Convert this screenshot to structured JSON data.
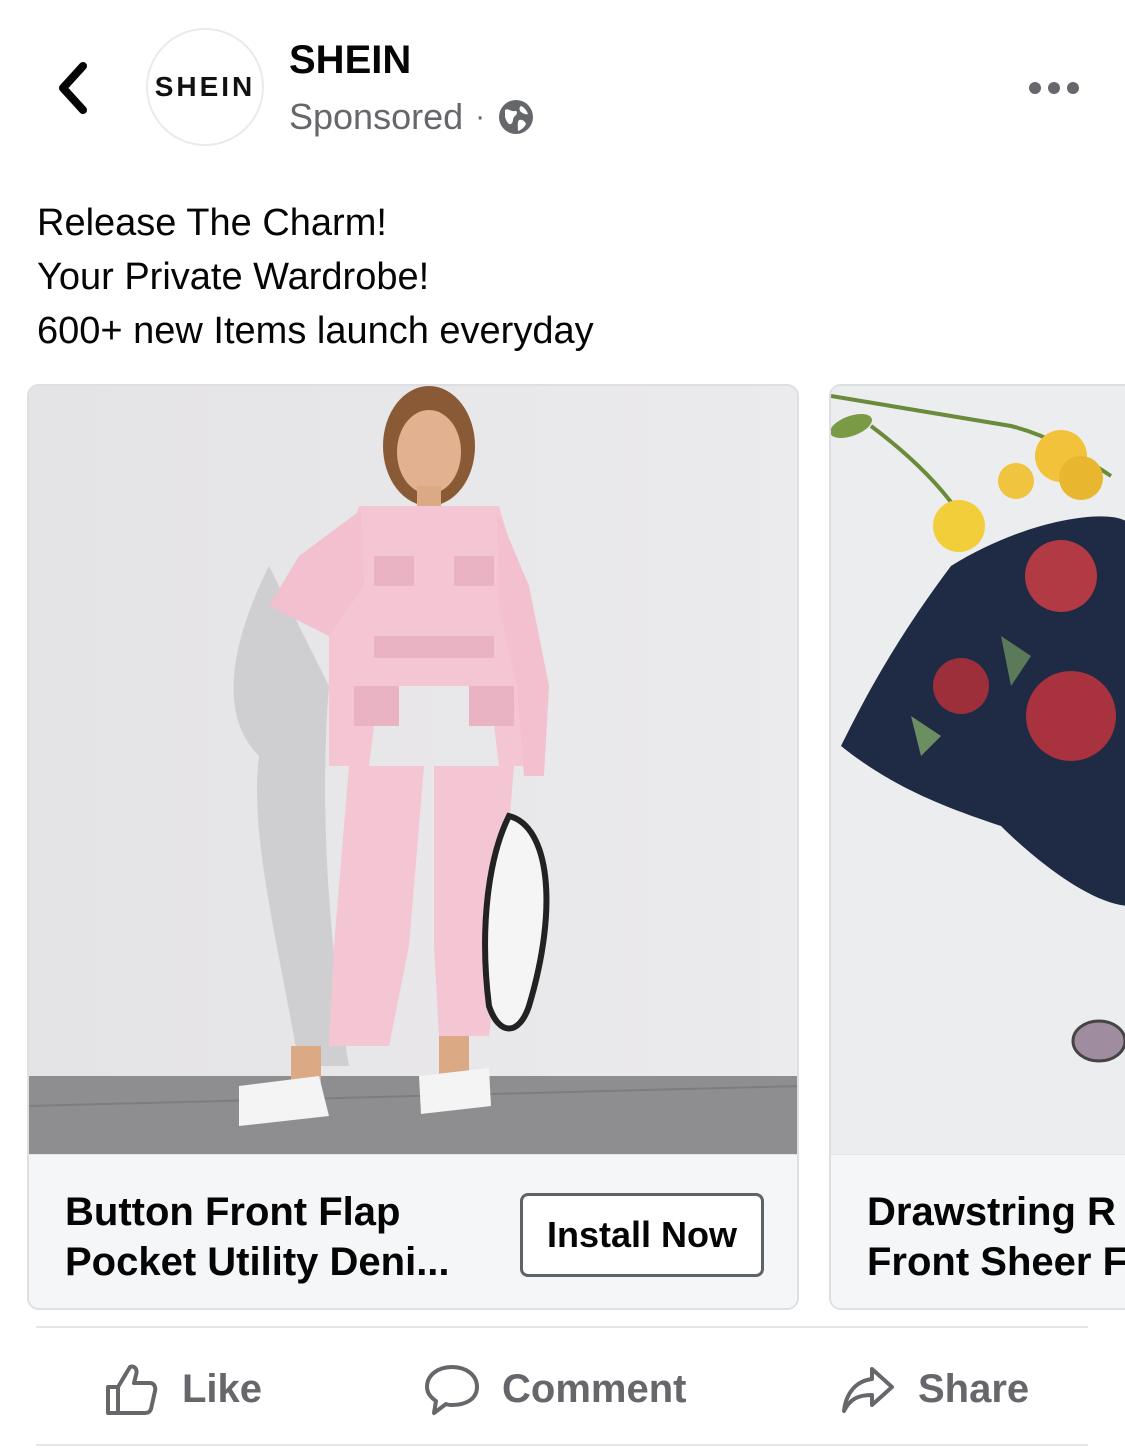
{
  "header": {
    "back_icon": "chevron-left-icon",
    "avatar_text": "SHEIN",
    "page_name": "SHEIN",
    "sponsored_label": "Sponsored",
    "separator": "·",
    "audience_icon": "globe-icon",
    "more_icon": "more-horizontal-icon"
  },
  "post": {
    "caption_lines": [
      "Release The Charm!",
      "Your Private Wardrobe!",
      "600+ new Items launch everyday"
    ]
  },
  "carousel": {
    "cards": [
      {
        "title": "Button Front Flap Pocket Utility Deni...",
        "cta_label": "Install Now",
        "image": "pink-denim-jumpsuit-photo"
      },
      {
        "title": "Drawstring R\nFront Sheer F",
        "image": "floral-sheer-top-photo"
      }
    ]
  },
  "actions": {
    "like_label": "Like",
    "comment_label": "Comment",
    "share_label": "Share"
  },
  "colors": {
    "text_primary": "#050505",
    "text_secondary": "#65676b",
    "divider": "#e4e6eb",
    "card_bg": "#f5f6f7"
  }
}
